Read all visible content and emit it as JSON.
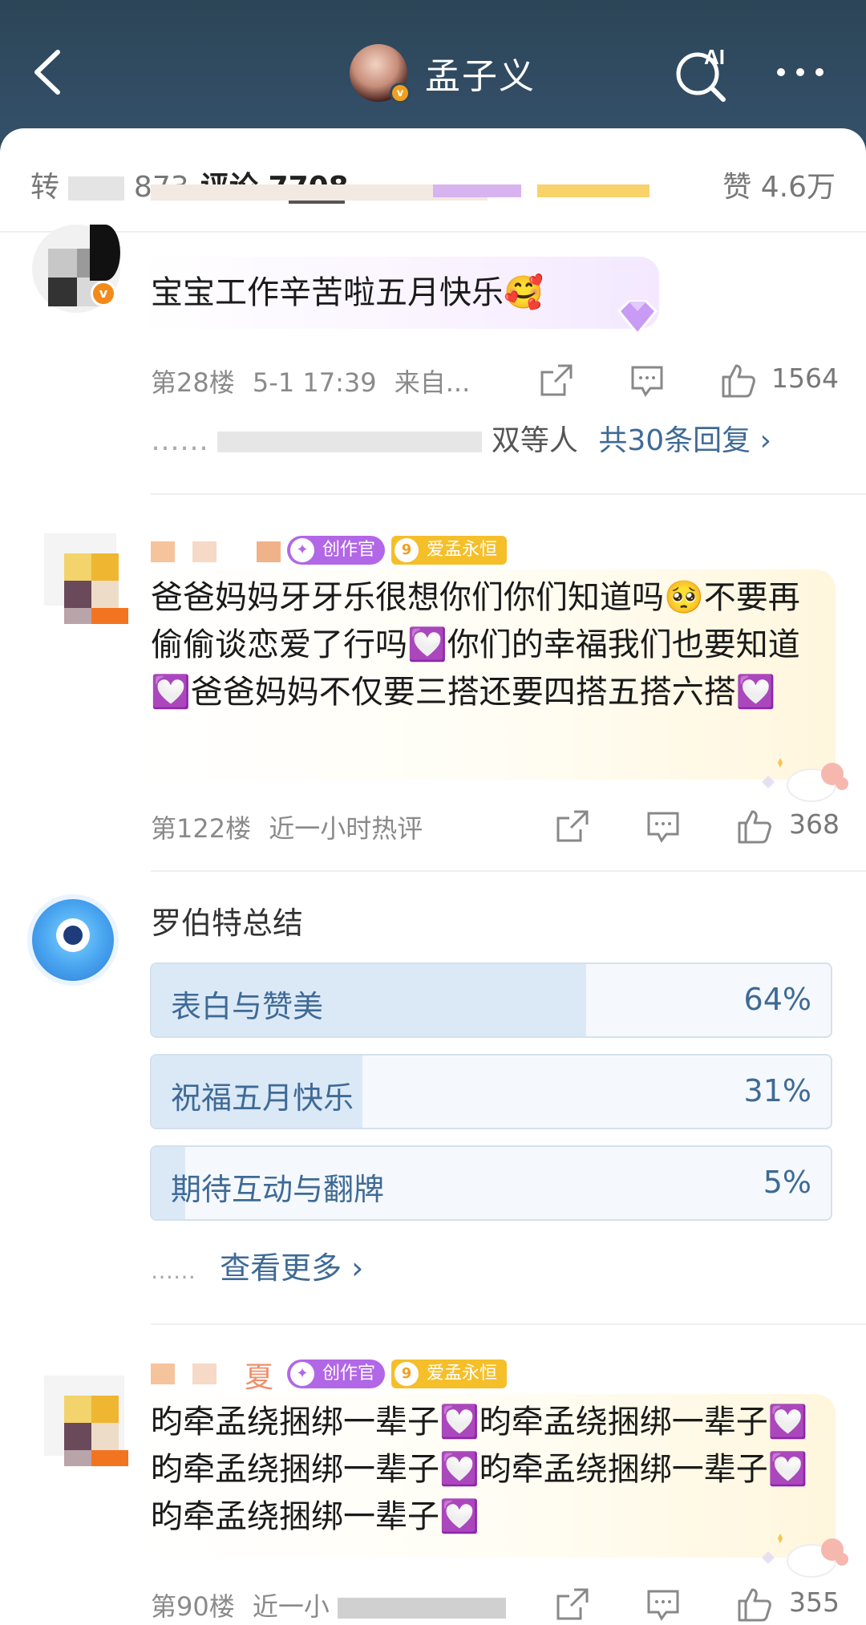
{
  "header": {
    "title": "孟子义",
    "back_icon": "chevron-left-icon",
    "ai_search_icon": "ai-search-icon",
    "more_icon": "more-dots-icon"
  },
  "tabs": {
    "repost": "转",
    "repost_count": "873",
    "comment": "评论 7708",
    "like": "赞 4.6万"
  },
  "comments": [
    {
      "text": "宝宝工作辛苦啦五月快乐🥰",
      "floor": "第28楼",
      "time": "5-1 17:39",
      "source": "来自...",
      "likes": "1564",
      "reply_summary": "双等人",
      "reply_link": "共30条回复 ›"
    },
    {
      "badge_creator": "创作官",
      "badge_fan_level": "9",
      "badge_fan": "爱孟永恒",
      "text": "爸爸妈妈牙牙乐很想你们你们知道吗🥺不要再偷偷谈恋爱了行吗💟你们的幸福我们也要知道💟爸爸妈妈不仅要三搭还要四搭五搭六搭💟",
      "floor": "第122楼",
      "time": "近一小时热评",
      "likes": "368"
    },
    {
      "badge_creator": "创作官",
      "badge_fan_level": "9",
      "badge_fan": "爱孟永恒",
      "name_fragment": "夏",
      "text": "昀牵孟绕捆绑一辈子💟昀牵孟绕捆绑一辈子💟昀牵孟绕捆绑一辈子💟昀牵孟绕捆绑一辈子💟昀牵孟绕捆绑一辈子💟",
      "floor": "第90楼",
      "time": "近一小",
      "likes": "355"
    }
  ],
  "summary": {
    "title": "罗伯特总结",
    "items": [
      {
        "label": "表白与赞美",
        "percent": "64%",
        "value": 0.64
      },
      {
        "label": "祝福五月快乐",
        "percent": "31%",
        "value": 0.31
      },
      {
        "label": "期待互动与翻牌",
        "percent": "5%",
        "value": 0.05
      }
    ],
    "more_prefix": "……",
    "more": "查看更多 ›"
  },
  "colors": {
    "header_bg": "#2f4a5c",
    "link": "#3f6a96",
    "poll_fill": "#dbe9f7"
  }
}
